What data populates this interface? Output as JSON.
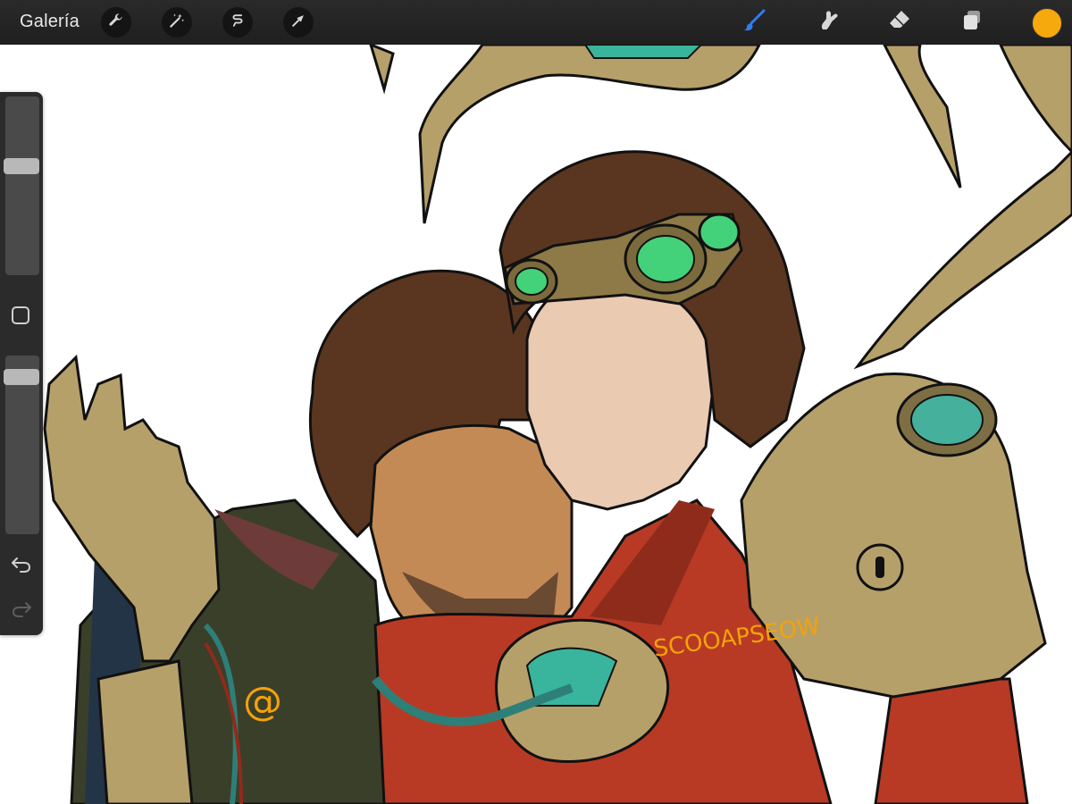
{
  "app": {
    "gallery_label": "Galería"
  },
  "toolbar": {
    "left_tools": [
      {
        "name": "wrench-icon",
        "label": "Actions"
      },
      {
        "name": "magic-wand-icon",
        "label": "Adjustments"
      },
      {
        "name": "selection-icon",
        "label": "Selection"
      },
      {
        "name": "arrow-icon",
        "label": "Transform"
      }
    ],
    "right_tools": [
      {
        "name": "brush-icon",
        "active": true
      },
      {
        "name": "smudge-icon",
        "active": false
      },
      {
        "name": "eraser-icon",
        "active": false
      },
      {
        "name": "layers-icon",
        "active": false
      }
    ],
    "current_color": "#f6a90d",
    "active_tool_color": "#2f7df6"
  },
  "sidebar": {
    "brush_size_level": 0.62,
    "opacity_level": 0.92,
    "undo_icon": "undo-icon",
    "redo_icon": "redo-icon"
  },
  "canvas": {
    "signature_text": "SCOOAPSEOW",
    "signature_symbol": "@",
    "signature_color": "#f2a20a"
  }
}
